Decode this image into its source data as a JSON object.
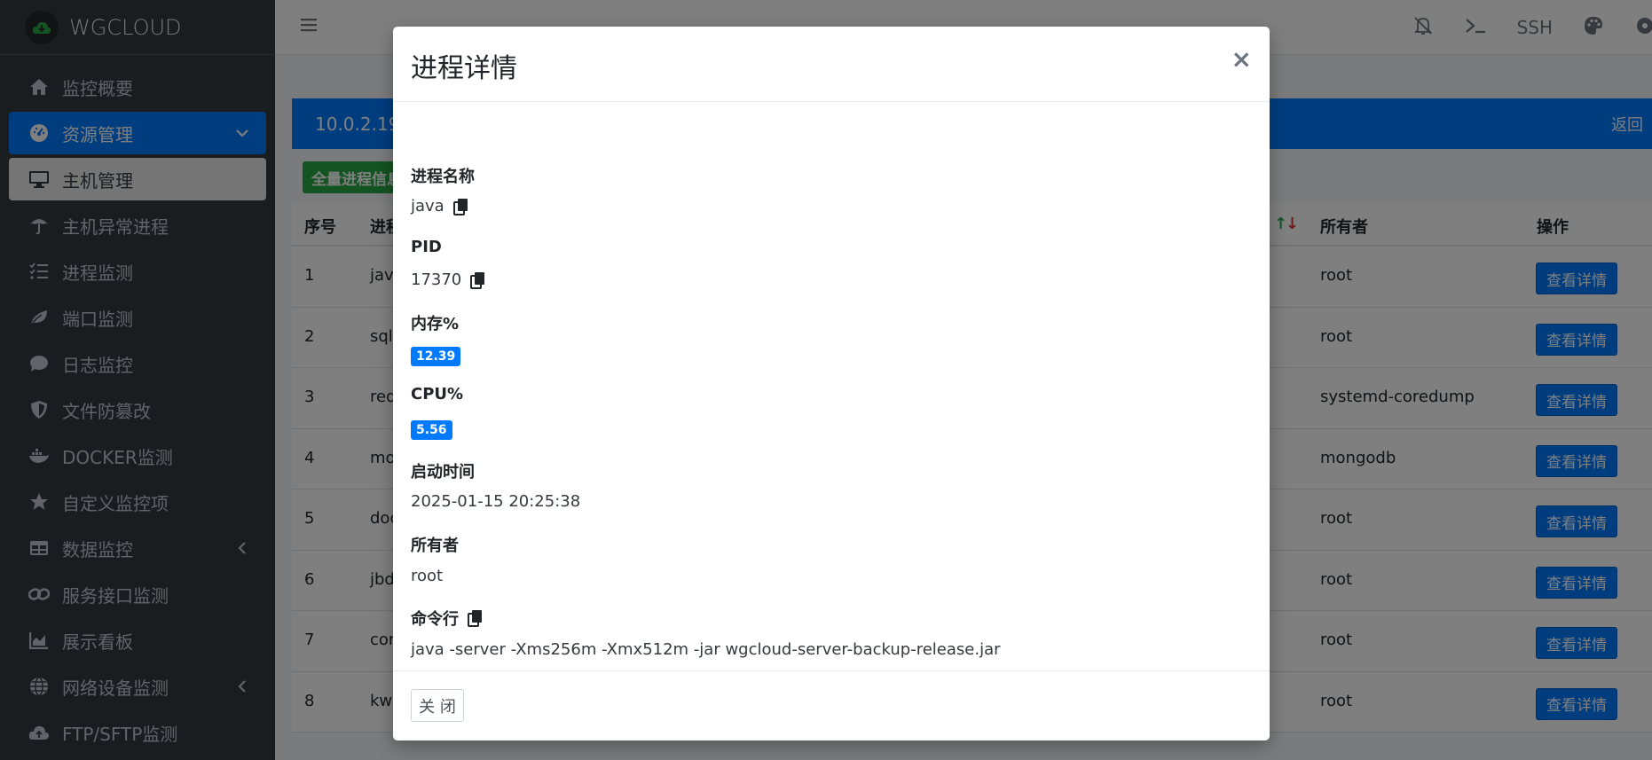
{
  "brand": {
    "name": "WGCLOUD"
  },
  "sidebar": {
    "items": [
      {
        "label": "监控概要",
        "icon": "home-icon"
      },
      {
        "label": "资源管理",
        "icon": "dashboard-icon"
      },
      {
        "label": "主机管理",
        "icon": "desktop-icon"
      },
      {
        "label": "主机异常进程",
        "icon": "umbrella-icon"
      },
      {
        "label": "进程监测",
        "icon": "tasks-icon"
      },
      {
        "label": "端口监测",
        "icon": "leaf-icon"
      },
      {
        "label": "日志监控",
        "icon": "comment-icon"
      },
      {
        "label": "文件防篡改",
        "icon": "shield-icon"
      },
      {
        "label": "DOCKER监测",
        "icon": "docker-icon"
      },
      {
        "label": "自定义监控项",
        "icon": "star-icon"
      },
      {
        "label": "数据监控",
        "icon": "table-icon"
      },
      {
        "label": "服务接口监测",
        "icon": "link-icon"
      },
      {
        "label": "展示看板",
        "icon": "chart-icon"
      },
      {
        "label": "网络设备监测",
        "icon": "globe-icon"
      },
      {
        "label": "FTP/SFTP监测",
        "icon": "cloud-upload-icon"
      }
    ]
  },
  "topbar": {
    "ssh_label": "SSH"
  },
  "content": {
    "header_title": "10.0.2.19",
    "back_label": "返回",
    "green_button": "全量进程信息",
    "columns": [
      "序号",
      "进程",
      "所有者",
      "操作"
    ],
    "rows": [
      {
        "no": "1",
        "proc": "java",
        "owner": "root",
        "action": "查看详情"
      },
      {
        "no": "2",
        "proc": "sqls",
        "owner": "root",
        "action": "查看详情"
      },
      {
        "no": "3",
        "proc": "redi",
        "owner": "systemd-coredump",
        "action": "查看详情"
      },
      {
        "no": "4",
        "proc": "mon",
        "owner": "mongodb",
        "action": "查看详情"
      },
      {
        "no": "5",
        "proc": "doc",
        "owner": "root",
        "action": "查看详情"
      },
      {
        "no": "6",
        "proc": "jbd",
        "owner": "root",
        "action": "查看详情"
      },
      {
        "no": "7",
        "proc": "con",
        "owner": "root",
        "action": "查看详情"
      },
      {
        "no": "8",
        "proc": "kw",
        "owner": "root",
        "action": "查看详情"
      }
    ]
  },
  "modal": {
    "title": "进程详情",
    "close_symbol": "×",
    "fields": {
      "name_label": "进程名称",
      "name_value": "java",
      "pid_label": "PID",
      "pid_value": "17370",
      "mem_label": "内存%",
      "mem_value": "12.39",
      "cpu_label": "CPU%",
      "cpu_value": "5.56",
      "start_label": "启动时间",
      "start_value": "2025-01-15 20:25:38",
      "owner_label": "所有者",
      "owner_value": "root",
      "cmd_label": "命令行",
      "cmd_value": "java -server -Xms256m -Xmx512m -jar wgcloud-server-backup-release.jar"
    },
    "close_button": "关 闭"
  },
  "colors": {
    "primary": "#007bff",
    "success": "#28a745",
    "sidebar": "#343a40"
  }
}
